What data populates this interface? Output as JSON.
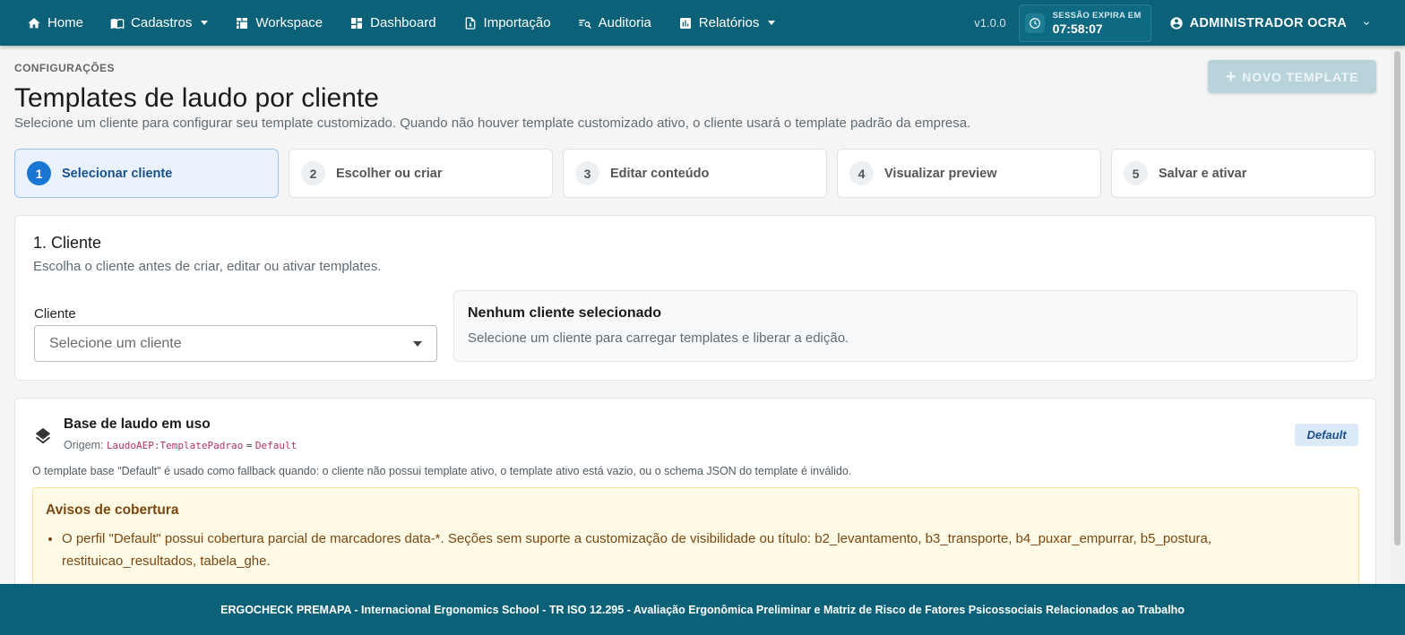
{
  "nav": {
    "items": [
      {
        "label": "Home",
        "icon": "home-icon"
      },
      {
        "label": "Cadastros",
        "icon": "book-icon",
        "dropdown": true
      },
      {
        "label": "Workspace",
        "icon": "workspace-icon"
      },
      {
        "label": "Dashboard",
        "icon": "dashboard-icon"
      },
      {
        "label": "Importação",
        "icon": "file-import-icon"
      },
      {
        "label": "Auditoria",
        "icon": "audit-search-icon"
      },
      {
        "label": "Relatórios",
        "icon": "chart-icon",
        "dropdown": true
      }
    ],
    "version": "v1.0.0",
    "session_label": "SESSÃO EXPIRA EM",
    "session_time": "07:58:07",
    "user_name": "ADMINISTRADOR OCRA"
  },
  "header": {
    "overline": "CONFIGURAÇÕES",
    "title": "Templates de laudo por cliente",
    "subtitle": "Selecione um cliente para configurar seu template customizado. Quando não houver template customizado ativo, o cliente usará o template padrão da empresa.",
    "new_template_label": "NOVO TEMPLATE"
  },
  "steps": [
    {
      "num": "1",
      "label": "Selecionar cliente",
      "active": true
    },
    {
      "num": "2",
      "label": "Escolher ou criar",
      "active": false
    },
    {
      "num": "3",
      "label": "Editar conteúdo",
      "active": false
    },
    {
      "num": "4",
      "label": "Visualizar preview",
      "active": false
    },
    {
      "num": "5",
      "label": "Salvar e ativar",
      "active": false
    }
  ],
  "client_card": {
    "title": "1. Cliente",
    "desc": "Escolha o cliente antes de criar, editar ou ativar templates.",
    "field_label": "Cliente",
    "select_placeholder": "Selecione um cliente",
    "empty_title": "Nenhum cliente selecionado",
    "empty_desc": "Selecione um cliente para carregar templates e liberar a edição."
  },
  "base_card": {
    "title": "Base de laudo em uso",
    "origin_label": "Origem:",
    "origin_key": "LaudoAEP:TemplatePadrao",
    "origin_eq": "=",
    "origin_value": "Default",
    "badge": "Default",
    "note": "O template base \"Default\" é usado como fallback quando: o cliente não possui template ativo, o template ativo está vazio, ou o schema JSON do template é inválido.",
    "warn_title": "Avisos de cobertura",
    "warn_items": [
      "O perfil \"Default\" possui cobertura parcial de marcadores data-*. Seções sem suporte a customização de visibilidade ou título: b2_levantamento, b3_transporte, b4_puxar_empurrar, b5_postura, restituicao_resultados, tabela_ghe."
    ]
  },
  "footer": {
    "text": "ERGOCHECK PREMAPA - Internacional Ergonomics School - TR ISO 12.295 - Avaliação Ergonômica Preliminar e Matriz de Risco de Fatores Psicossociais Relacionados ao Trabalho"
  },
  "colors": {
    "brand": "#0b6178",
    "accent": "#1976d2",
    "warning_bg": "#fffbe6",
    "warning_text": "#7a4713"
  }
}
